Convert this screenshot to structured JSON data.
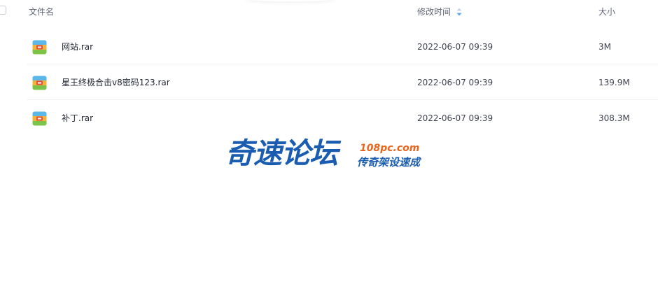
{
  "columns": {
    "name": "文件名",
    "modified": "修改时间",
    "size": "大小"
  },
  "files": [
    {
      "name": "网站.rar",
      "modified": "2022-06-07 09:39",
      "size": "3M",
      "icon": "rar-archive-icon"
    },
    {
      "name": "星王终极合击v8密码123.rar",
      "modified": "2022-06-07 09:39",
      "size": "139.9M",
      "icon": "rar-archive-icon"
    },
    {
      "name": "补丁.rar",
      "modified": "2022-06-07 09:39",
      "size": "308.3M",
      "icon": "rar-archive-icon"
    }
  ],
  "watermark": {
    "main": "奇速论坛",
    "url": "108pc.com",
    "slogan": "传奇架设速成"
  },
  "colors": {
    "watermark_blue": "#1a5db0",
    "watermark_orange": "#e8661c",
    "sort_icon": "#5aa7f0"
  }
}
